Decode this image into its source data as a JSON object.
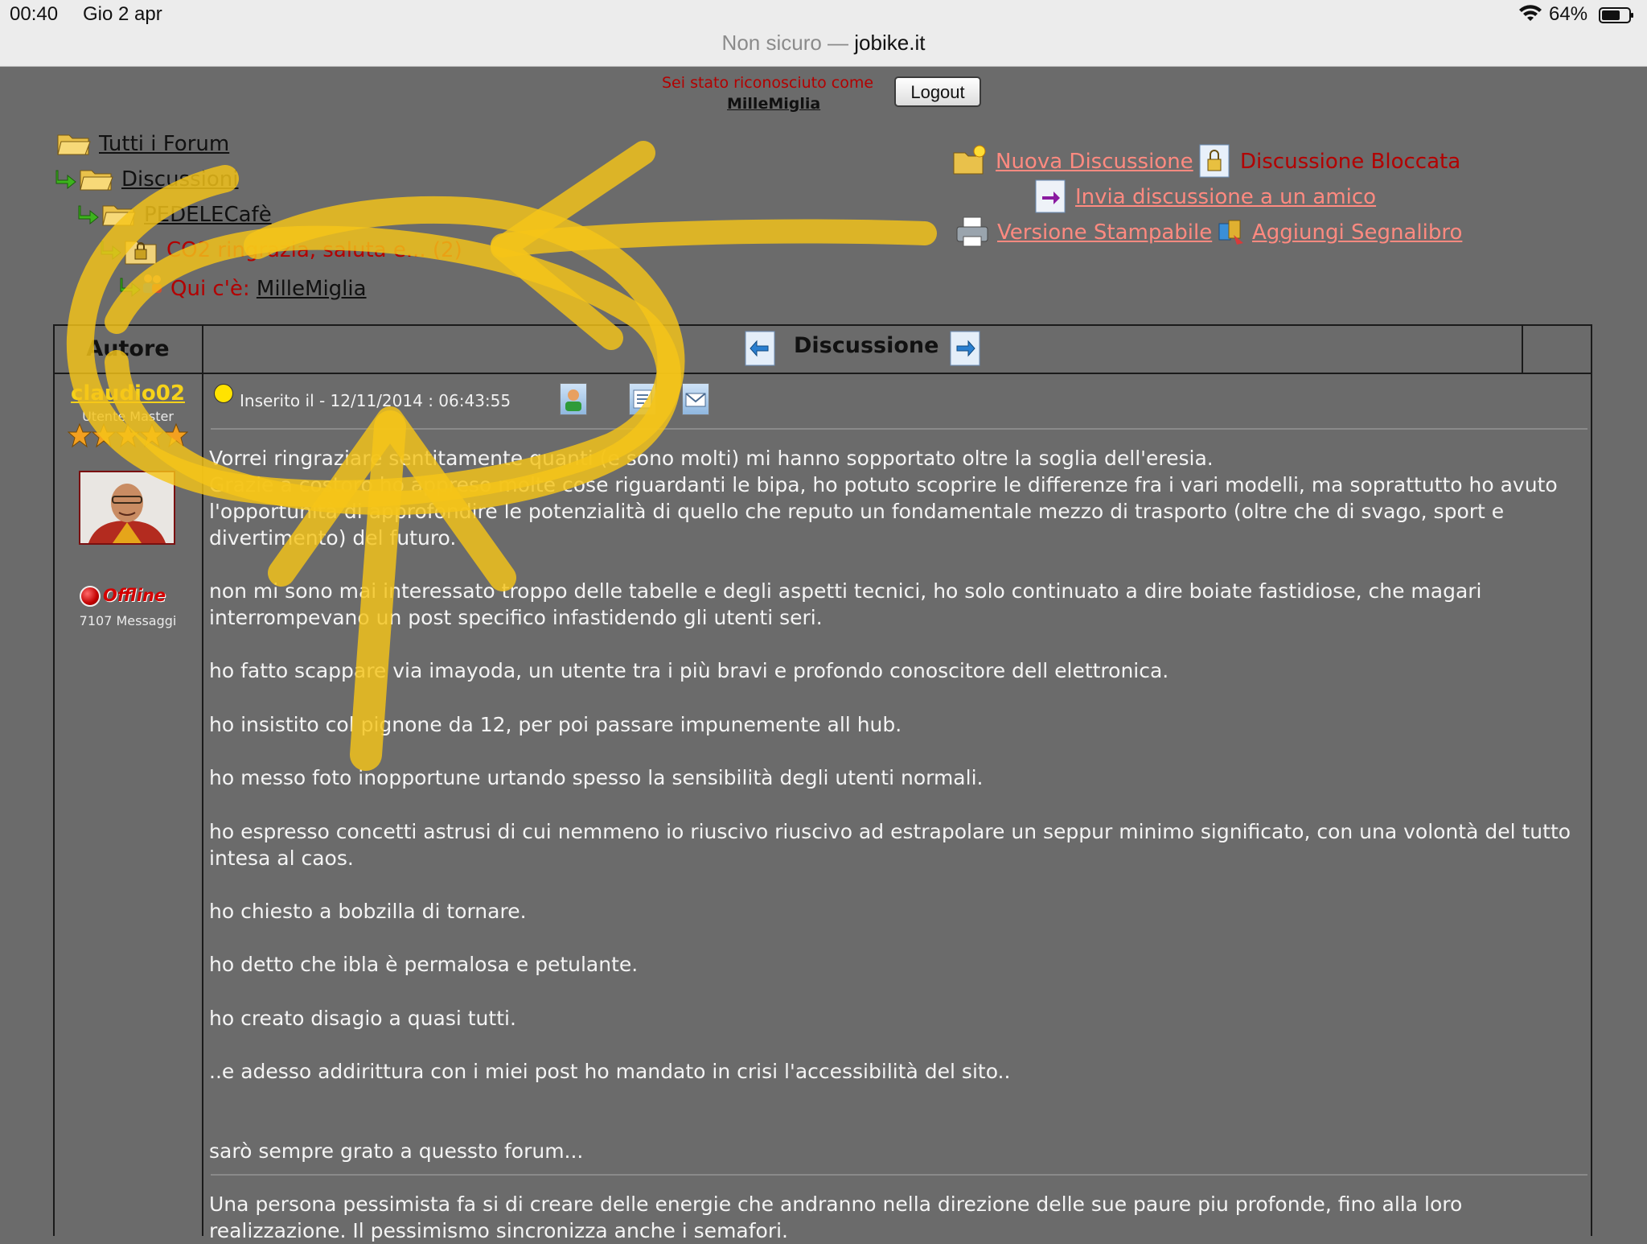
{
  "status_bar": {
    "time": "00:40",
    "date": "Gio 2 apr",
    "battery": "64%"
  },
  "address_bar": {
    "security": "Non sicuro —",
    "domain": "jobike.it"
  },
  "login": {
    "message": "Sei stato riconosciuto come",
    "username": "MilleMiglia",
    "logout_label": "Logout"
  },
  "breadcrumb": {
    "all_forums": "Tutti i Forum",
    "discussions": "Discussioni",
    "category": "PEDELECafè",
    "topic": "CO2 ringrazia, saluta e... (2)",
    "here_label": "Qui c'è:",
    "here_user": "MilleMiglia"
  },
  "actions": {
    "new_discussion": "Nuova Discussione",
    "locked": "Discussione Bloccata",
    "send_friend": "Invia discussione a un amico",
    "printable": "Versione Stampabile",
    "bookmark": "Aggiungi Segnalibro"
  },
  "table": {
    "col_author": "Autore",
    "col_discussion": "Discussione"
  },
  "author": {
    "name": "claudio02",
    "rank": "Utente Master",
    "stars": 5,
    "status": "Offline",
    "messages": "7107 Messaggi"
  },
  "post": {
    "posted_on": "Inserito il - 12/11/2014 : 06:43:55",
    "paragraphs": [
      "Vorrei ringraziare sentitamente quanti (e sono molti) mi hanno sopportato oltre la soglia dell'eresia.\nGrazie a costoro ho appreso molte cose riguardanti le bipa, ho potuto scoprire le differenze fra i vari modelli, ma soprattutto ho avuto l'opportunità di approfondire le potenzialità di quello che reputo un fondamentale mezzo di trasporto (oltre che di svago, sport e divertimento) del futuro.",
      "non mi sono mai interessato troppo delle tabelle e degli aspetti tecnici, ho solo continuato a dire boiate fastidiose, che magari interrompevano un post specifico infastidendo gli utenti seri.",
      "ho fatto scappare via imayoda, un utente tra i più bravi e profondo conoscitore dell elettronica.",
      "ho insistito col pignone da 12, per poi passare impunemente all hub.",
      "ho messo foto inopportune urtando spesso la sensibilità degli utenti normali.",
      "ho espresso concetti astrusi di cui nemmeno io riuscivo riuscivo ad estrapolare un seppur minimo significato, con una volontà del tutto intesa al caos.",
      "ho chiesto a bobzilla di tornare.",
      "ho detto che ibla è permalosa e petulante.",
      "ho creato disagio a quasi tutti.",
      "..e adesso addirittura con i miei post ho mandato in crisi l'accessibilità del sito..",
      "sarò sempre grato a quessto forum..."
    ],
    "signature": "Una persona pessimista fa si di creare delle energie che andranno nella direzione delle sue paure piu profonde, fino alla loro realizzazione. Il pessimismo sincronizza anche i semafori."
  },
  "colors": {
    "page_bg": "#6b6b6b",
    "link": "#ff8a80",
    "alert": "#b30000",
    "author": "#f6d21a",
    "highlighter": "#f5c518"
  }
}
